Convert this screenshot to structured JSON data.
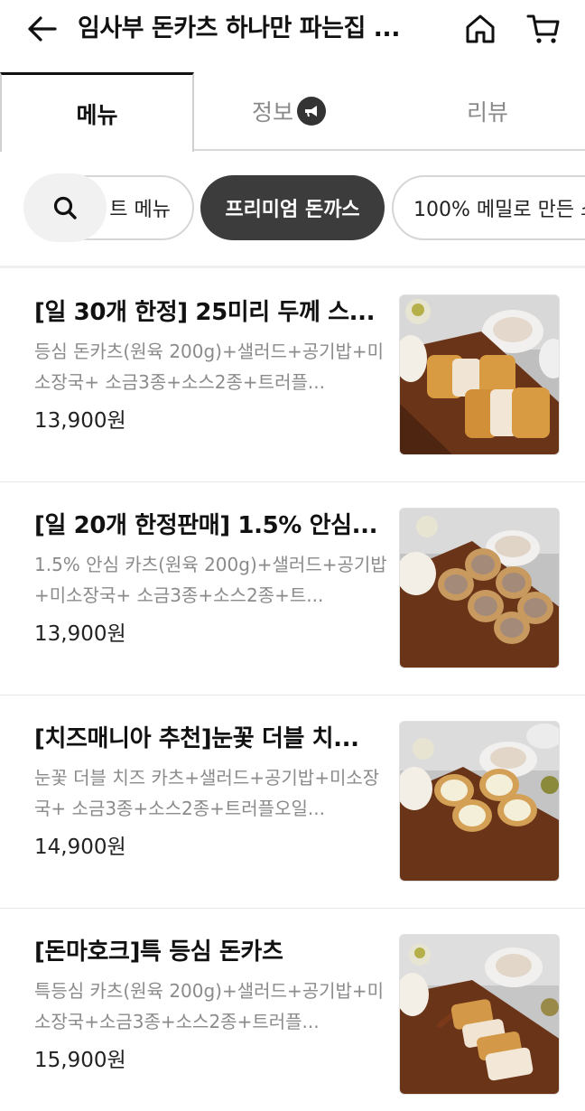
{
  "header": {
    "title": "임사부 돈카츠 하나만 파는집 ...",
    "back_icon": "arrow-left-icon",
    "home_icon": "home-icon",
    "cart_icon": "cart-icon"
  },
  "tabs": [
    {
      "label": "메뉴",
      "active": true
    },
    {
      "label": "정보",
      "badge_icon": "megaphone-icon"
    },
    {
      "label": "리뷰"
    }
  ],
  "categories": {
    "search_icon": "search-icon",
    "items": [
      {
        "label": "트 메뉴"
      },
      {
        "label": "프리미엄 돈까스",
        "active": true
      },
      {
        "label": "100% 메밀로 만든 소"
      }
    ],
    "active_color": "#3c3c3c"
  },
  "menu": [
    {
      "name": "[일 30개 한정] 25미리 두께 스...",
      "description": "등심 돈카츠(원육 200g)+샐러드+공기밥+미소장국+ 소금3종+소스2종+트러플...",
      "price": "13,900원"
    },
    {
      "name": "[일 20개 한정판매] 1.5% 안심...",
      "description": "1.5% 안심 카츠(원육 200g)+샐러드+공기밥+미소장국+ 소금3종+소스2종+트...",
      "price": "13,900원"
    },
    {
      "name": "[치즈매니아 추천]눈꽃 더블 치...",
      "description": "눈꽃 더블 치즈 카츠+샐러드+공기밥+미소장국+ 소금3종+소스2종+트러플오일...",
      "price": "14,900원"
    },
    {
      "name": "[돈마호크]특 등심 돈카츠",
      "description": "특등심 카츠(원육 200g)+샐러드+공기밥+미소장국+소금3종+소스2종+트러플...",
      "price": "15,900원"
    }
  ]
}
